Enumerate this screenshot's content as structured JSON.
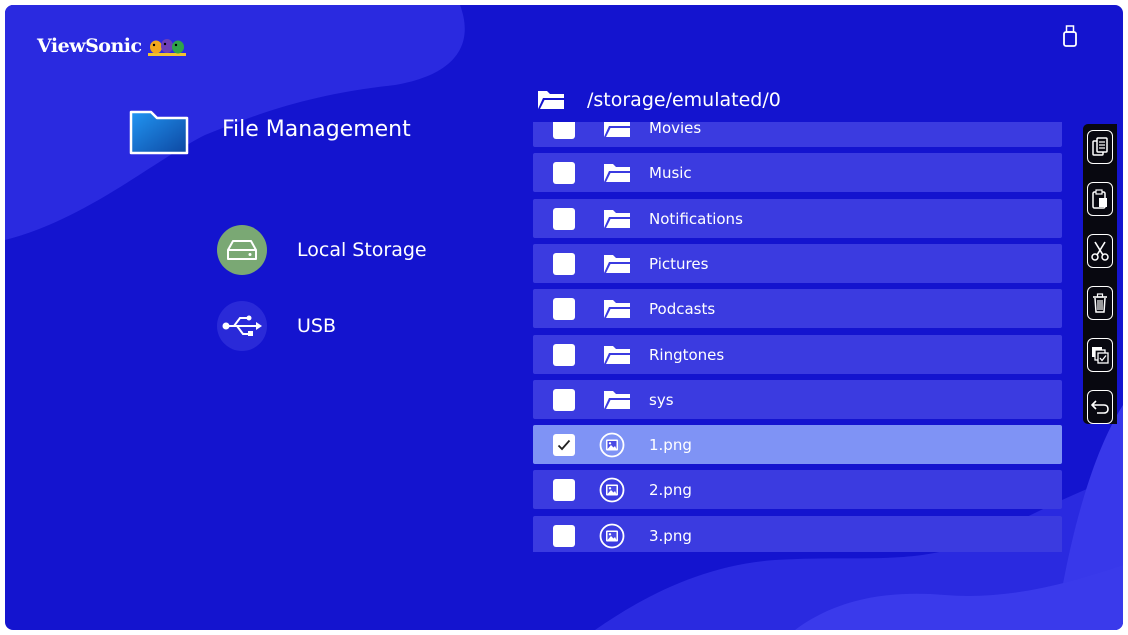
{
  "brand": {
    "name": "ViewSonic",
    "logo_icon": "birds-logo-icon"
  },
  "status": {
    "usb_icon": "usb-drive-icon"
  },
  "title": "File Management",
  "sidebar": {
    "items": [
      {
        "label": "Local Storage",
        "icon": "hard-drive-icon",
        "color": "#7aa874"
      },
      {
        "label": "USB",
        "icon": "usb-icon",
        "color": "#2a2ad8"
      }
    ]
  },
  "path": "/storage/emulated/0",
  "files": [
    {
      "name": "Movies",
      "type": "folder",
      "checked": false
    },
    {
      "name": "Music",
      "type": "folder",
      "checked": false
    },
    {
      "name": "Notifications",
      "type": "folder",
      "checked": false
    },
    {
      "name": "Pictures",
      "type": "folder",
      "checked": false
    },
    {
      "name": "Podcasts",
      "type": "folder",
      "checked": false
    },
    {
      "name": "Ringtones",
      "type": "folder",
      "checked": false
    },
    {
      "name": "sys",
      "type": "folder",
      "checked": false
    },
    {
      "name": "1.png",
      "type": "image",
      "checked": true
    },
    {
      "name": "2.png",
      "type": "image",
      "checked": false
    },
    {
      "name": "3.png",
      "type": "image",
      "checked": false
    }
  ],
  "toolbar": [
    {
      "icon": "copy-icon"
    },
    {
      "icon": "paste-icon"
    },
    {
      "icon": "cut-icon"
    },
    {
      "icon": "delete-icon"
    },
    {
      "icon": "select-all-icon"
    },
    {
      "icon": "back-icon"
    }
  ],
  "colors": {
    "background": "#1414cf",
    "row": "#3b3be0",
    "row_selected": "#7f93f5",
    "toolbar": "#080810"
  }
}
